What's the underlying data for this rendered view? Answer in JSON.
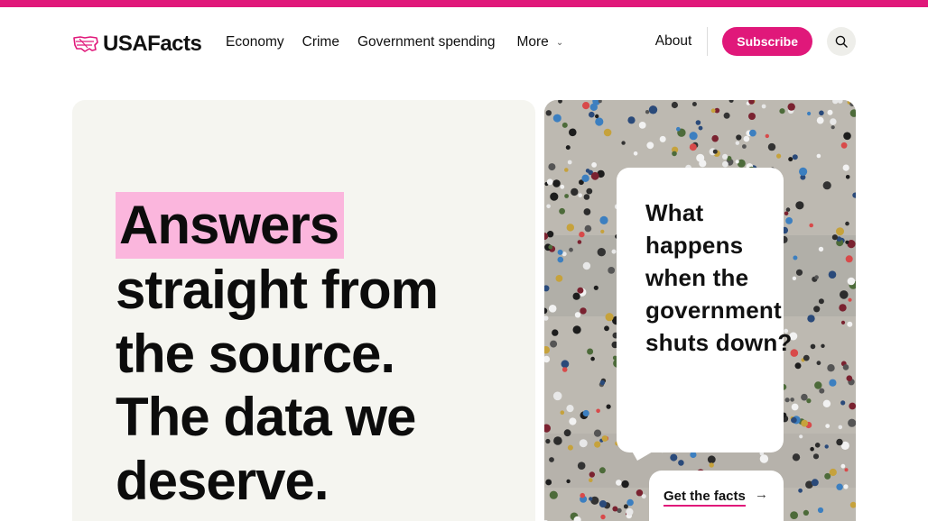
{
  "colors": {
    "accent": "#e0187a",
    "highlight": "#fbb6dd",
    "hero_bg": "#f5f5f0"
  },
  "header": {
    "logo_text": "USAFacts",
    "logo_icon": "us-map-flag-icon",
    "nav": [
      {
        "label": "Economy"
      },
      {
        "label": "Crime"
      },
      {
        "label": "Government spending"
      }
    ],
    "more_label": "More",
    "about_label": "About",
    "subscribe_label": "Subscribe",
    "search_icon": "search-icon"
  },
  "hero": {
    "highlight": "Answers",
    "line2": "straight from",
    "line3": "the source.",
    "line4": "The data we",
    "line5": "deserve."
  },
  "feature": {
    "image_subject": "aerial crowd of people",
    "question": "What happens when the government shuts down?",
    "cta_label": "Get the facts",
    "cta_icon": "arrow-right-icon"
  }
}
